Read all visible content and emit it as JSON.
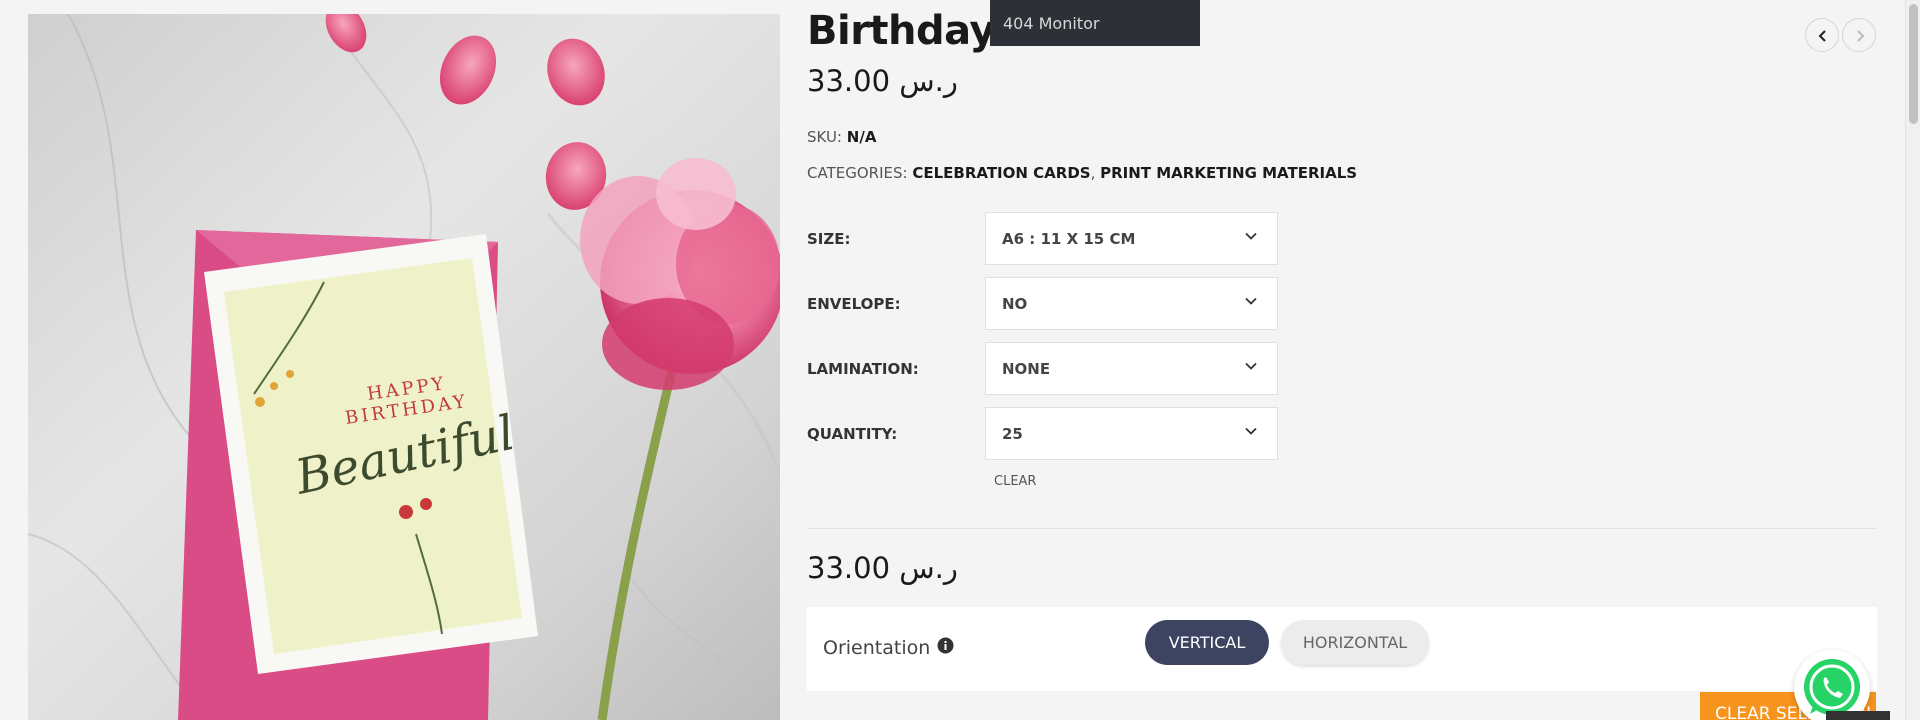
{
  "product": {
    "title": "Birthday Cards",
    "price_top": "33.00 ر.س",
    "price_bottom": "33.00 ر.س",
    "sku_label": "SKU:",
    "sku_value": "N/A",
    "categories_label": "CATEGORIES:",
    "categories": [
      "CELEBRATION CARDS",
      "PRINT MARKETING MATERIALS"
    ],
    "category_separator": ", "
  },
  "image": {
    "card_text_line1": "HAPPY",
    "card_text_line2": "BIRTHDAY",
    "card_text_line3": "Beautiful"
  },
  "variations": [
    {
      "label": "SIZE:",
      "value": "A6 : 11 X 15 CM"
    },
    {
      "label": "ENVELOPE:",
      "value": "NO"
    },
    {
      "label": "LAMINATION:",
      "value": "NONE"
    },
    {
      "label": "QUANTITY:",
      "value": "25"
    }
  ],
  "clear_label": "CLEAR",
  "orientation": {
    "label": "Orientation",
    "options": [
      "VERTICAL",
      "HORIZONTAL"
    ],
    "selected": "VERTICAL"
  },
  "clear_selection_label": "CLEAR SELECTION",
  "tooltip": "404 Monitor",
  "colors": {
    "accent_orange": "#f7941d",
    "selected_pill": "#3d4461",
    "whatsapp_green": "#25d366"
  },
  "icons": [
    "chevron-down-icon",
    "chevron-left-icon",
    "chevron-right-icon",
    "info-icon",
    "whatsapp-icon"
  ]
}
